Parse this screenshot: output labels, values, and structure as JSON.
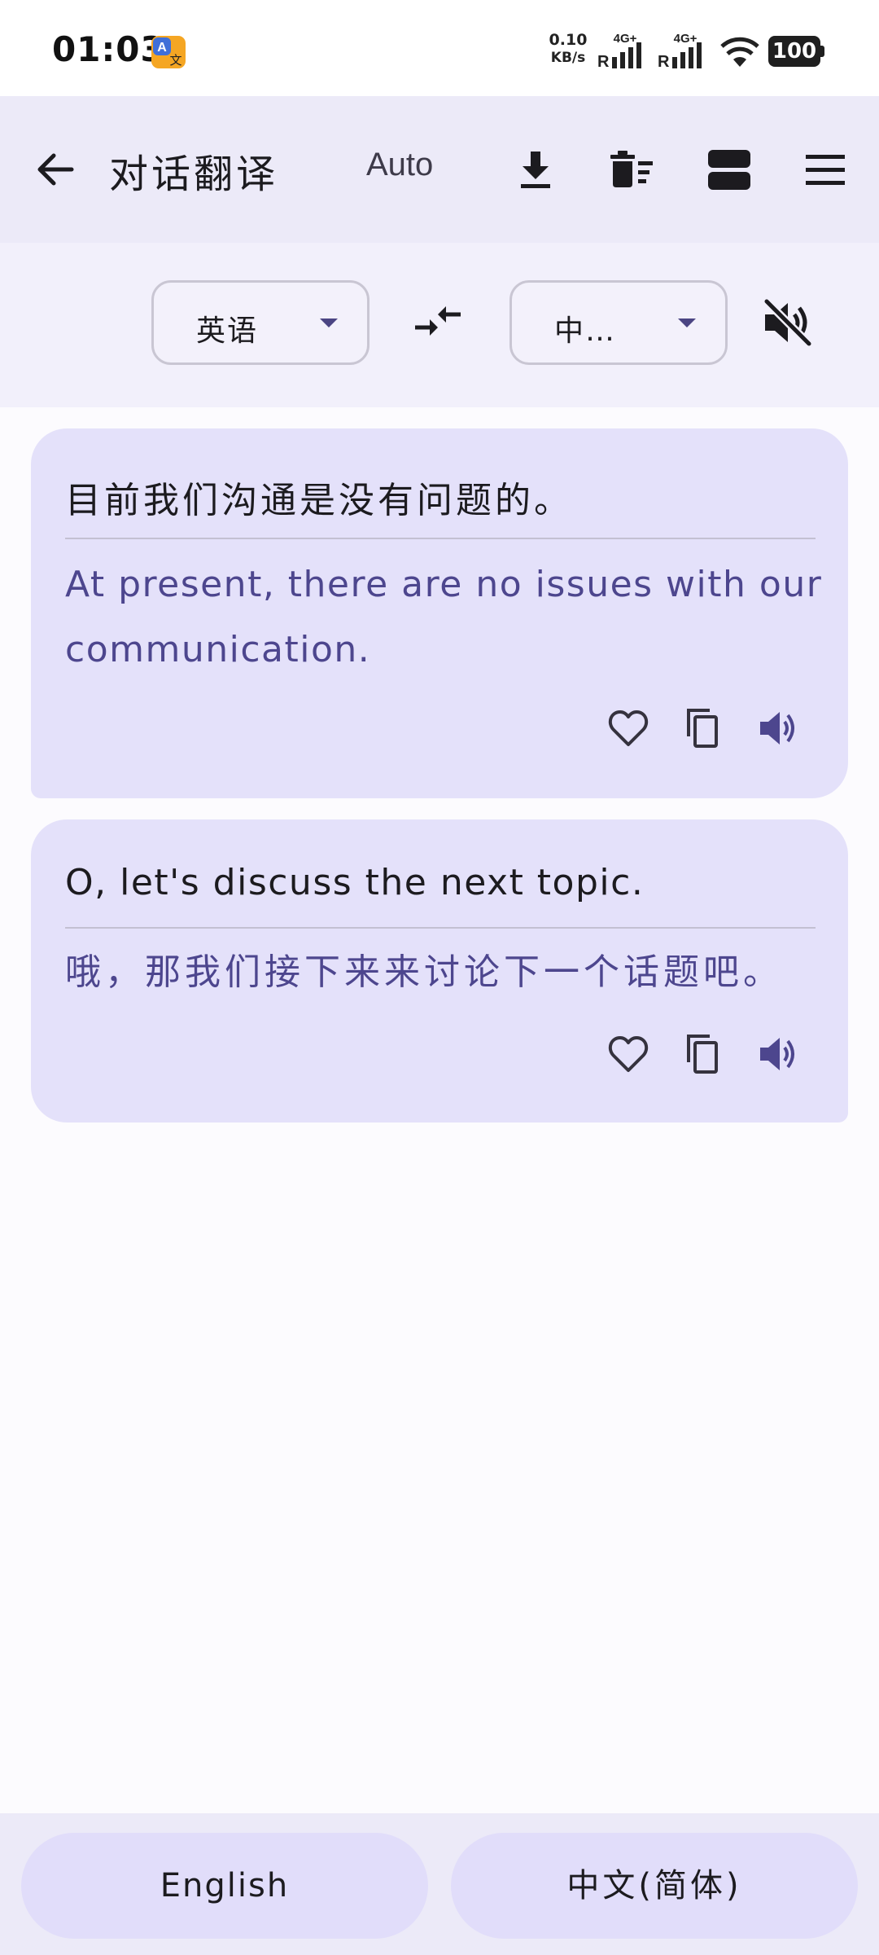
{
  "status_bar": {
    "time": "01:03",
    "net_speed_value": "0.10",
    "net_speed_unit": "KB/s",
    "signal1_label": "4G+",
    "signal2_label": "4G+",
    "battery": "100"
  },
  "app_bar": {
    "title": "对话翻译",
    "auto_label": "Auto",
    "icons": [
      "back-arrow-icon",
      "download-icon",
      "delete-sweep-icon",
      "split-layout-icon",
      "menu-icon"
    ]
  },
  "language_bar": {
    "source_language": "英语",
    "target_language": "中…",
    "icons": [
      "swap-languages-icon",
      "volume-off-icon"
    ]
  },
  "conversation": [
    {
      "source": "目前我们沟通是没有问题的。",
      "translation": "At present, there are no issues with our communication."
    },
    {
      "source": "O, let's discuss the next topic.",
      "translation": "哦，那我们接下来来讨论下一个话题吧。"
    }
  ],
  "bottom_bar": {
    "left_button": "English",
    "right_button": "中文(简体)"
  },
  "colors": {
    "accent": "#4D468E",
    "card": "#E4E1FA",
    "app_bar": "#ECEAF8"
  }
}
